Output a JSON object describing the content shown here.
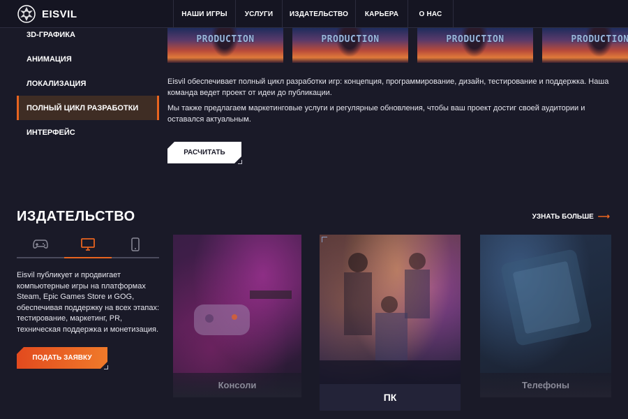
{
  "header": {
    "logo_text": "EISVIL",
    "nav": [
      "НАШИ ИГРЫ",
      "УСЛУГИ",
      "ИЗДАТЕЛЬСТВО",
      "КАРЬЕРА",
      "О НАС"
    ]
  },
  "services_menu": {
    "items": [
      "3D-ГРАФИКА",
      "АНИМАЦИЯ",
      "ЛОКАЛИЗАЦИЯ",
      "ПОЛНЫЙ ЦИКЛ РАЗРАБОТКИ",
      "ИНТЕРФЕЙС"
    ],
    "active_index": 3
  },
  "gallery": {
    "thumb_label": "PRODUCTION"
  },
  "service_detail": {
    "paragraph1": "Eisvil обеспечивает полный цикл разработки игр: концепция, программирование, дизайн, тестирование и поддержка. Наша команда ведет проект от идеи до публикации.",
    "paragraph2": "Мы также предлагаем маркетинговые услуги и регулярные обновления, чтобы ваш проект достиг своей аудитории и оставался актуальным.",
    "calc_button": "РАСЧИТАТЬ"
  },
  "publishing": {
    "title": "ИЗДАТЕЛЬСТВО",
    "learn_more": "УЗНАТЬ БОЛЬШЕ",
    "tabs": [
      {
        "icon": "gamepad-icon"
      },
      {
        "icon": "monitor-icon"
      },
      {
        "icon": "phone-icon"
      }
    ],
    "active_tab": 1,
    "description": "Eisvil публикует и продвигает компьютерные игры на платформах Steam, Epic Games Store и GOG, обеспечивая поддержку на всех этапах: тестирование, маркетинг, PR, техническая поддержка и монетизация.",
    "apply_button": "ПОДАТЬ ЗАЯВКУ",
    "cards": [
      {
        "label": "Консоли"
      },
      {
        "label": "ПК"
      },
      {
        "label": "Телефоны"
      }
    ]
  },
  "colors": {
    "background": "#1a1a28",
    "accent": "#e8641f",
    "active_menu_bg": "#3f2d24"
  }
}
